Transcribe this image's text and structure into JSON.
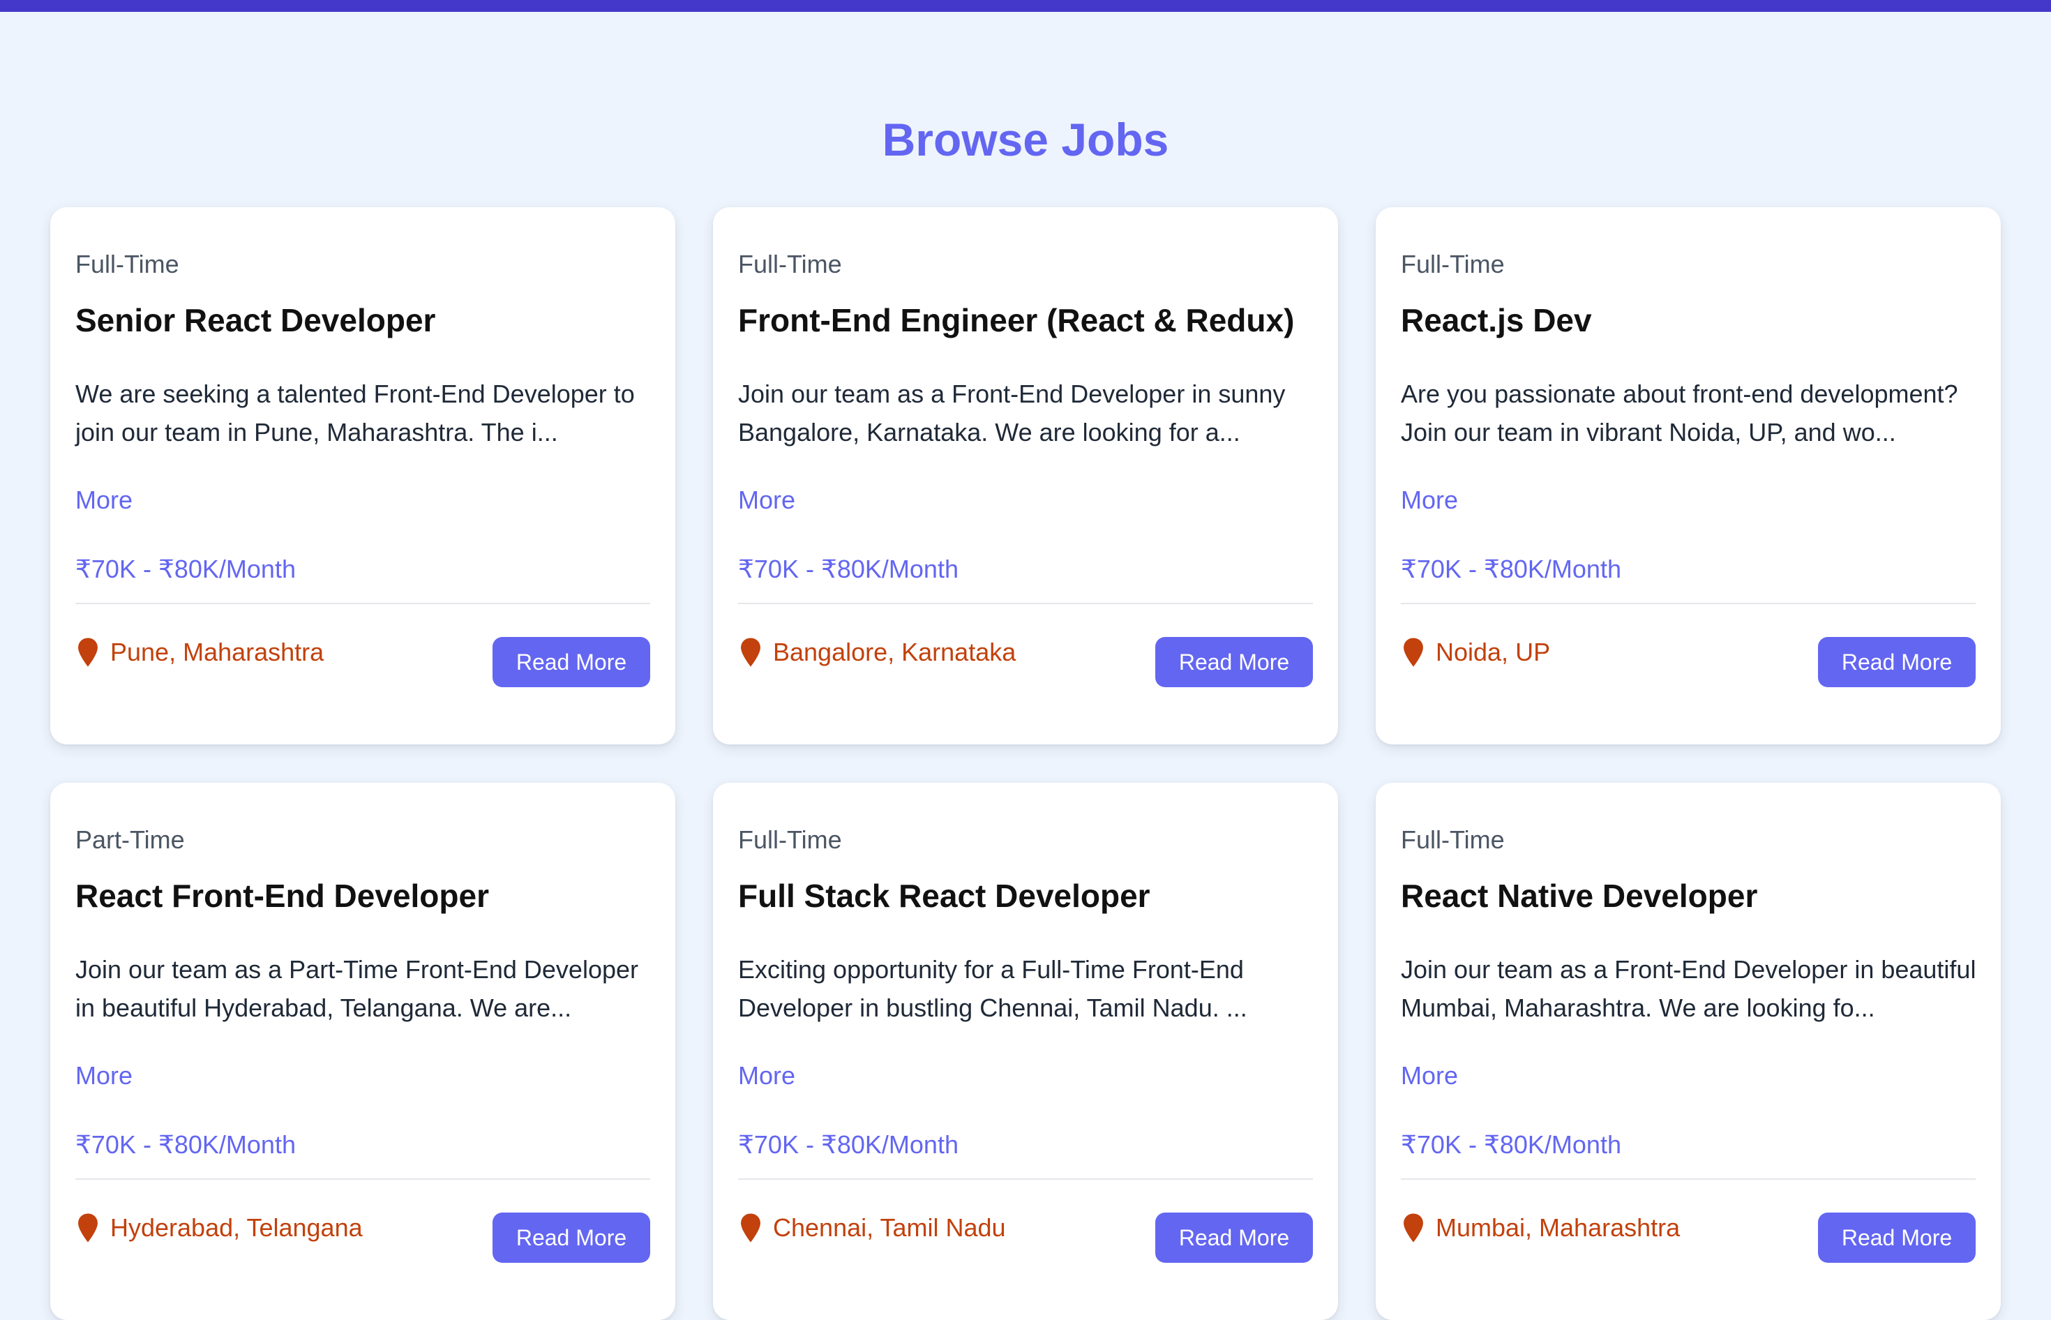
{
  "page": {
    "title": "Browse Jobs"
  },
  "colors": {
    "top_bar": "#4338ca",
    "accent": "#6366f1",
    "location": "#c2410c",
    "background": "#eef4fd"
  },
  "location_icon": "map-pin-icon",
  "jobs": [
    {
      "type": "Full-Time",
      "title": "Senior React Developer",
      "description": "We are seeking a talented Front-End Developer to join our team in Pune, Maharashtra. The i...",
      "more_label": "More",
      "salary": "₹70K - ₹80K/Month",
      "location": "Pune, Maharashtra",
      "button_label": "Read More"
    },
    {
      "type": "Full-Time",
      "title": "Front-End Engineer (React & Redux)",
      "description": "Join our team as a Front-End Developer in sunny Bangalore, Karnataka. We are looking for a...",
      "more_label": "More",
      "salary": "₹70K - ₹80K/Month",
      "location": "Bangalore, Karnataka",
      "button_label": "Read More"
    },
    {
      "type": "Full-Time",
      "title": "React.js Dev",
      "description": "Are you passionate about front-end development? Join our team in vibrant Noida, UP, and wo...",
      "more_label": "More",
      "salary": "₹70K - ₹80K/Month",
      "location": "Noida, UP",
      "button_label": "Read More"
    },
    {
      "type": "Part-Time",
      "title": "React Front-End Developer",
      "description": "Join our team as a Part-Time Front-End Developer in beautiful Hyderabad, Telangana. We are...",
      "more_label": "More",
      "salary": "₹70K - ₹80K/Month",
      "location": "Hyderabad, Telangana",
      "button_label": "Read More"
    },
    {
      "type": "Full-Time",
      "title": "Full Stack React Developer",
      "description": "Exciting opportunity for a Full-Time Front-End Developer in bustling Chennai, Tamil Nadu. ...",
      "more_label": "More",
      "salary": "₹70K - ₹80K/Month",
      "location": "Chennai, Tamil Nadu",
      "button_label": "Read More"
    },
    {
      "type": "Full-Time",
      "title": "React Native Developer",
      "description": "Join our team as a Front-End Developer in beautiful Mumbai, Maharashtra. We are looking fo...",
      "more_label": "More",
      "salary": "₹70K - ₹80K/Month",
      "location": "Mumbai, Maharashtra",
      "button_label": "Read More"
    }
  ]
}
